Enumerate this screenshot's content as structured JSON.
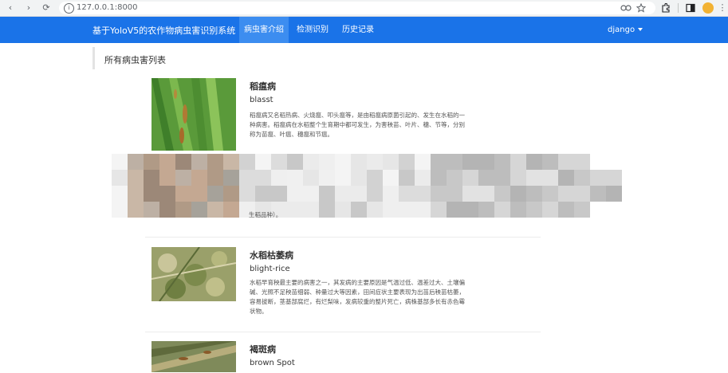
{
  "browser": {
    "url": "127.0.0.1:8000",
    "back_icon": "‹",
    "forward_icon": "›",
    "reload_icon": "⟳",
    "menu_icon": "⋮"
  },
  "navbar": {
    "brand": "基于YoloV5的农作物病虫害识别系统",
    "items": [
      {
        "label": "病虫害介绍",
        "active": true
      },
      {
        "label": "检测识别",
        "active": false
      },
      {
        "label": "历史记录",
        "active": false
      }
    ],
    "user": "django",
    "color": "#1a73e8"
  },
  "page": {
    "title": "所有病虫害列表"
  },
  "diseases": [
    {
      "name": "稻瘟病",
      "en": "blasst",
      "desc": "稻瘟病又名稻热病、火烧瘟、叩头瘟等，是由稻瘟病原菌引起的、发生在水稻的一种病害。稻瘟病在水稻整个生育期中都可发生，为害秧苗、叶片、穗、节等，分别称为苗瘟、叶瘟、穗瘟和节瘟。"
    },
    {
      "name": "",
      "en": "",
      "desc": "生稻品种）。"
    },
    {
      "name": "水稻枯萎病",
      "en": "blight-rice",
      "desc": "水稻早育秧最主要的病害之一，其发病的主要原因是气温过低、温差过大、土壤偏碱、光照不足秧苗细弱、种量过大等因素，田间症状主要表现为出苗后秧苗枯萎，容易拔断，茎基部腐烂，有烂梨味，发病较重的整片死亡，病株基部多长有赤色霉状物。"
    },
    {
      "name": "褐斑病",
      "en": "brown Spot",
      "desc": ""
    }
  ]
}
